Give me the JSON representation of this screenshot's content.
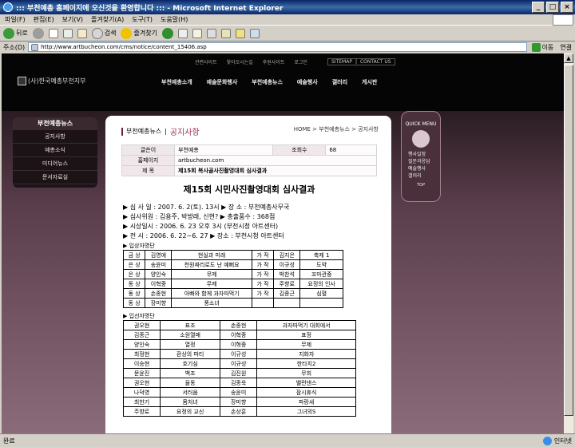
{
  "window": {
    "title": "::: 부천예총 홈페이지에 오신것을 환영합니다 ::: - Microsoft Internet Explorer",
    "buttons": [
      "_",
      "□",
      "×"
    ]
  },
  "menubar": [
    "파일(F)",
    "편집(E)",
    "보기(V)",
    "즐겨찾기(A)",
    "도구(T)",
    "도움말(H)"
  ],
  "toolbar": {
    "back": "뒤로",
    "search": "검색",
    "favorites": "즐겨찾기"
  },
  "address": {
    "label": "주소(D)",
    "url": "http://www.artbucheon.com/cms/notice/content_15406.asp",
    "go": "이동",
    "links": "연결"
  },
  "site": {
    "util_links": [
      "관련사이트",
      "찾아오시는길",
      "후원사이트",
      "로그인"
    ],
    "util_links2": [
      "SITEMAP",
      "CONTACT US"
    ],
    "logo": "(사)한국예총부천지부",
    "gnb": [
      "부천예총소개",
      "예술문화행사",
      "부천예총뉴스",
      "예술행사",
      "갤러리",
      "게시판"
    ],
    "lnb": {
      "header": "부천예총뉴스",
      "items": [
        "공지사항",
        "예총소식",
        "미디어뉴스",
        "문서자료실"
      ]
    },
    "quick": {
      "header": "QUICK MENU",
      "items": [
        "행사일정",
        "질문과응답",
        "예술행사",
        "갤러리"
      ],
      "top": "TOP"
    },
    "breadcrumb_section": "부천예총뉴스",
    "breadcrumb_current": "공지사항",
    "breadcrumb_path": "HOME > 부천예총뉴스 > 공지사항",
    "info": {
      "writer_label": "글쓴이",
      "writer": "부천예총",
      "views_label": "조회수",
      "views": "68",
      "homepage_label": "홈페이지",
      "homepage": "artbucheon.com",
      "subject_label": "제 목",
      "subject": "제15회 복사골사진촬영대회 심사결과"
    },
    "article": {
      "title": "제15회 시민사진촬영대회 심사결과",
      "meta": [
        "▶ 심 사 일 : 2007. 6. 2(토). 13시        ▶ 장   소 : 부천예총사무국",
        "▶ 심사위원 : 김용주, 박방래, 신현?        ▶  총출품수 : 368점",
        "▶ 시상일시 : 2006. 6. 23 오후 3시 (부천시청 아트센터)",
        "▶ 전     시 : 2006. 6. 22~6. 27         ▶ 장소 : 부천시청 아트센터"
      ],
      "section1": "▶ 입상자명단",
      "winners": [
        [
          "금 상",
          "김영애",
          "현실과 미래",
          "가 작",
          "김지은",
          "축제 1"
        ],
        [
          "은 상",
          "송윤미",
          "천원짜리로도 난 예뻐요",
          "가 작",
          "이규성",
          "도약"
        ],
        [
          "은 상",
          "양인숙",
          "무제",
          "가 작",
          "박찬석",
          "꼬마관중"
        ],
        [
          "동 상",
          "이혁중",
          "무제",
          "가 작",
          "주향로",
          "요정의 인사"
        ],
        [
          "동 상",
          "손종현",
          "아빠와 함께 과자따먹기",
          "가 작",
          "김종근",
          "심혈"
        ],
        [
          "동 상",
          "장미향",
          "풍소녀",
          "",
          "",
          ""
        ]
      ],
      "section2": "▶ 입선자명단",
      "entries": [
        [
          "권오현",
          "표조",
          "손종현",
          "과자따먹기 대회에서"
        ],
        [
          "김종근",
          "소원열매",
          "이혁중",
          "표정"
        ],
        [
          "양인숙",
          "열정",
          "이혁중",
          "무제"
        ],
        [
          "최정현",
          "환상의 파티",
          "이규성",
          "지화자"
        ],
        [
          "이승현",
          "호기심",
          "이규성",
          "한타치2"
        ],
        [
          "문윤진",
          "백조",
          "김진원",
          "무희"
        ],
        [
          "권오현",
          "율동",
          "김종욱",
          "밸런댄스"
        ],
        [
          "나덕영",
          "서러움",
          "송윤미",
          "잠시휴식"
        ],
        [
          "최한기",
          "몸처녀",
          "장미향",
          "파랑새"
        ],
        [
          "주향로",
          "요정의 교신",
          "손상훈",
          "그녀의S"
        ]
      ]
    }
  },
  "status": {
    "left": "완료",
    "zone": "인터넷"
  }
}
